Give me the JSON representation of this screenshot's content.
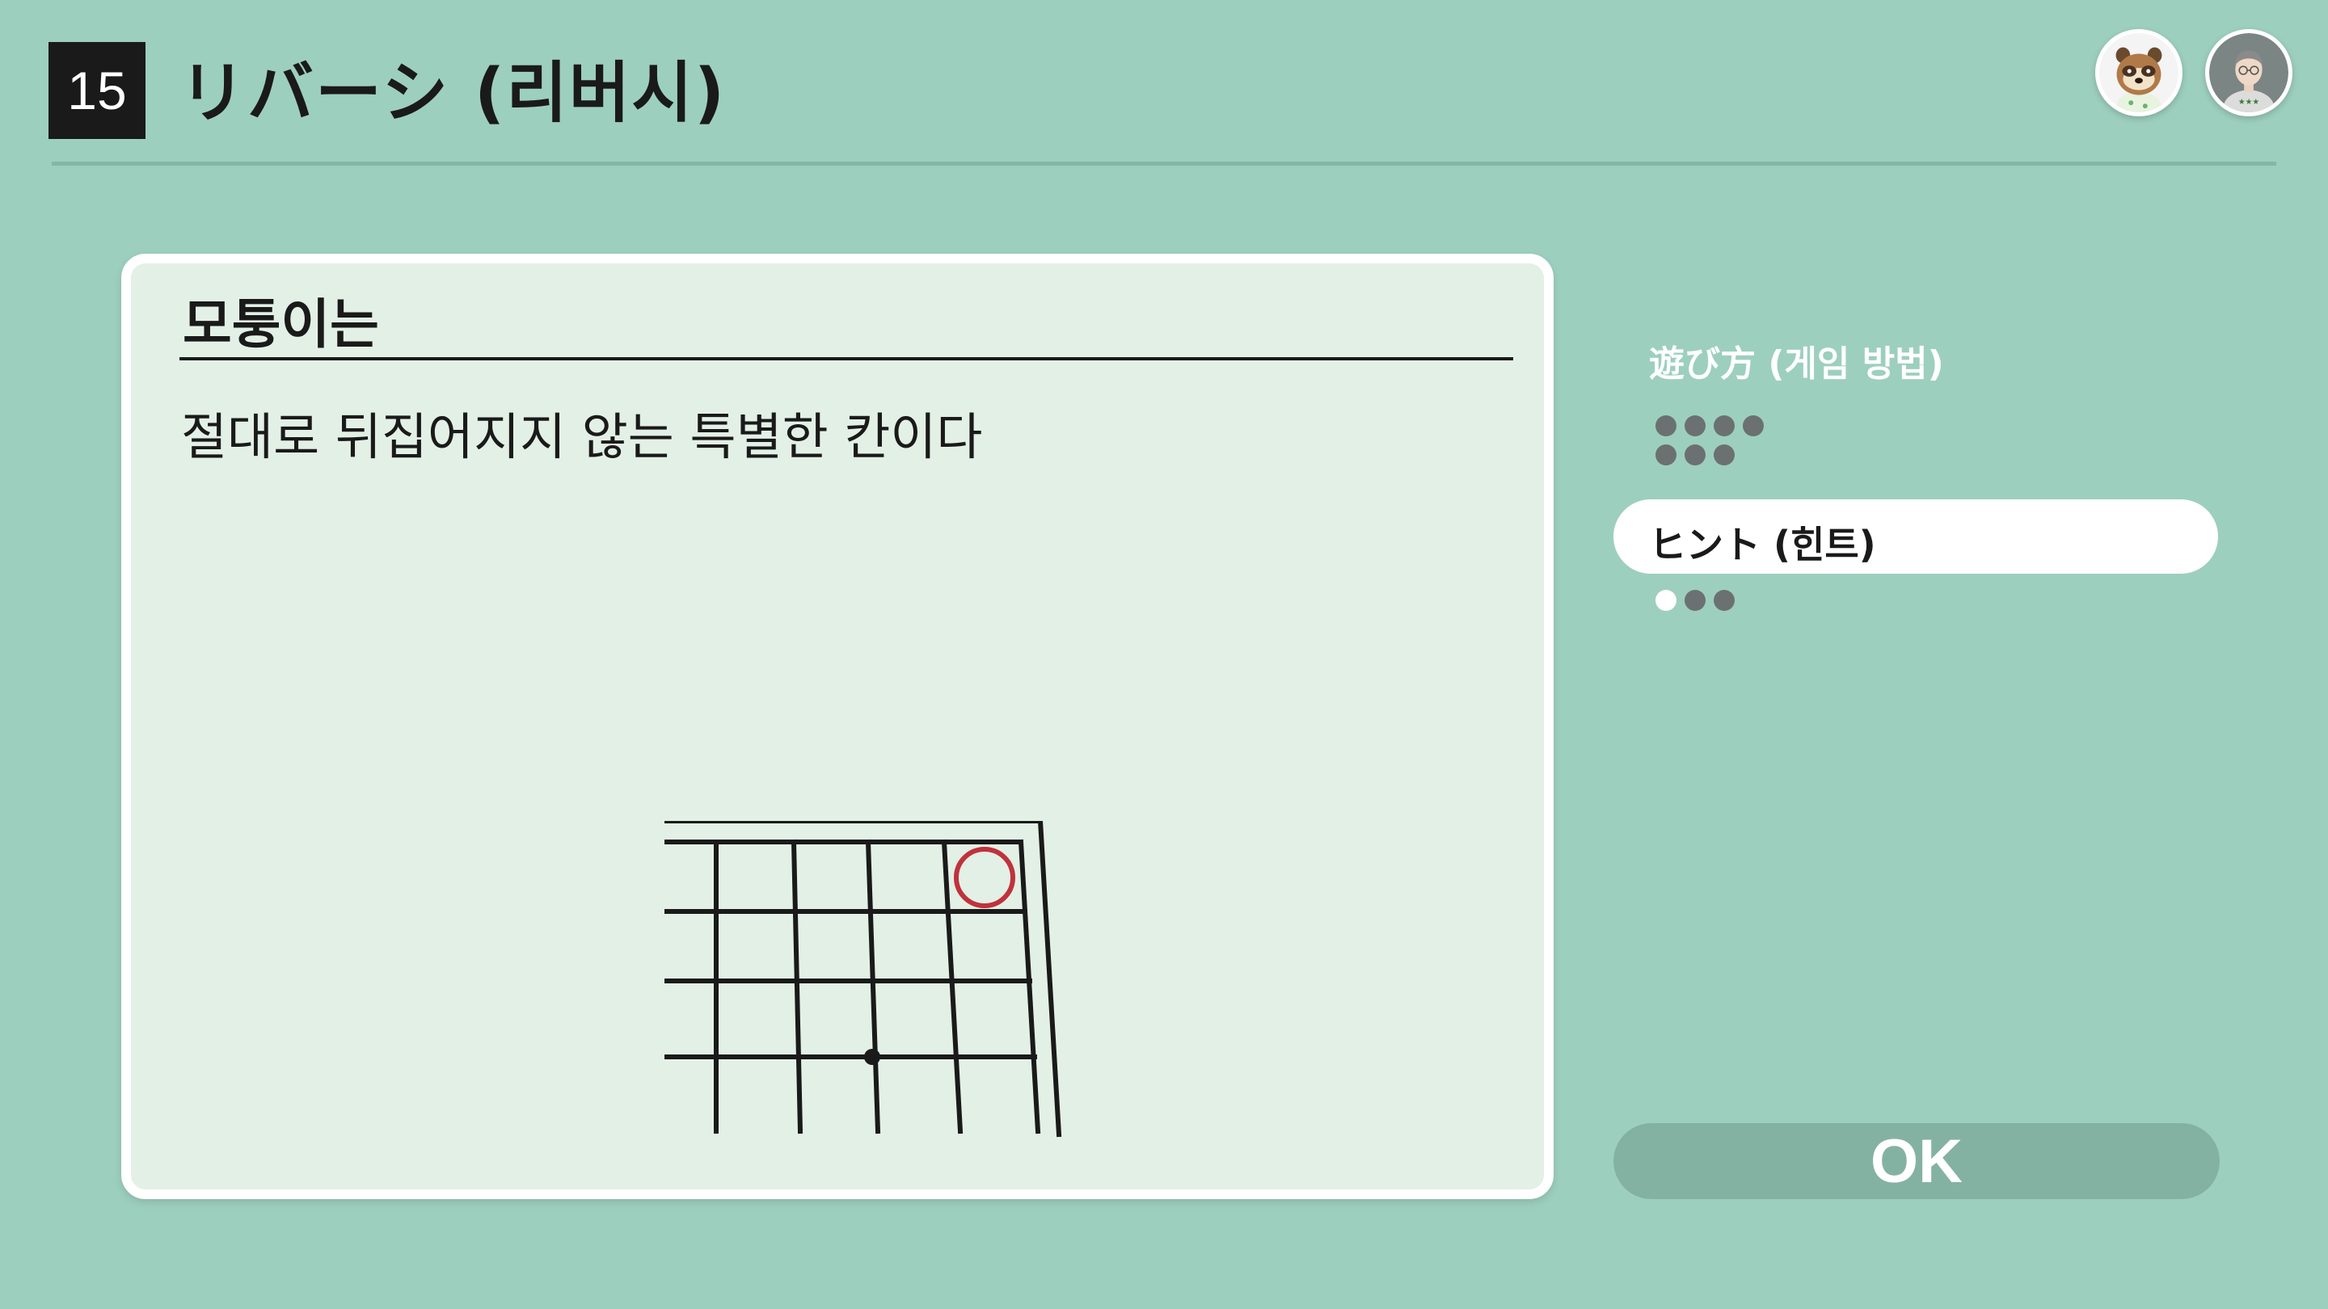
{
  "header": {
    "game_number": "15",
    "title": "リバーシ (리버시)"
  },
  "avatars": [
    {
      "icon": "raccoon-character-avatar-icon"
    },
    {
      "icon": "person-avatar-icon"
    }
  ],
  "card": {
    "title": "모퉁이는",
    "body": "절대로 뒤집어지지 않는 특별한 칸이다",
    "illustration": "board-corner-illustration"
  },
  "side_nav": {
    "how_to_play_label": "遊び方 (게임 방법)",
    "how_to_play_pages": 7,
    "hint_label": "ヒント (힌트)",
    "hint_pages": 3,
    "hint_current_page": 1
  },
  "ok_button": {
    "label": "OK"
  },
  "colors": {
    "background": "#9dcfbe",
    "card": "#e3f0e6",
    "accent_circle": "#c0323c",
    "button": "#84b2a2"
  }
}
